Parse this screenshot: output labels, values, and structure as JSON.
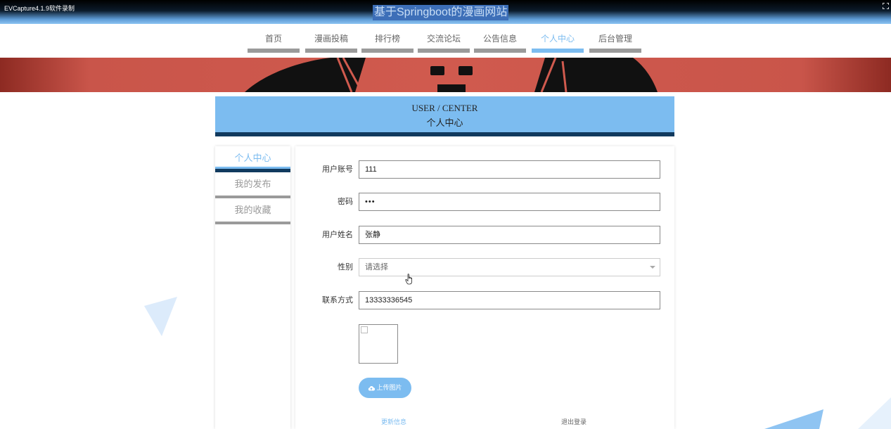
{
  "recorder": {
    "label": "EVCapture4.1.9软件录制"
  },
  "site": {
    "title": "基于Springboot的漫画网站"
  },
  "nav": {
    "items": [
      {
        "label": "首页",
        "active": false
      },
      {
        "label": "漫画投稿",
        "active": false
      },
      {
        "label": "排行榜",
        "active": false
      },
      {
        "label": "交流论坛",
        "active": false
      },
      {
        "label": "公告信息",
        "active": false
      },
      {
        "label": "个人中心",
        "active": true
      },
      {
        "label": "后台管理",
        "active": false
      }
    ]
  },
  "header": {
    "en": "USER / CENTER",
    "cn": "个人中心"
  },
  "sidebar": {
    "items": [
      {
        "label": "个人中心",
        "active": true
      },
      {
        "label": "我的发布",
        "active": false
      },
      {
        "label": "我的收藏",
        "active": false
      }
    ]
  },
  "form": {
    "account": {
      "label": "用户账号",
      "value": "111"
    },
    "password": {
      "label": "密码",
      "value": "•••"
    },
    "name": {
      "label": "用户姓名",
      "value": "张静"
    },
    "gender": {
      "label": "性别",
      "placeholder": "请选择"
    },
    "phone": {
      "label": "联系方式",
      "value": "13333336545"
    },
    "upload_label": "上传图片",
    "update_label": "更新信息",
    "logout_label": "退出登录"
  },
  "colors": {
    "accent": "#7cbcf0",
    "dark_bar": "#113a5e",
    "banner": "#d05a4e"
  },
  "icons": {
    "upload": "cloud-upload-icon",
    "cursor": "hand-pointer-icon",
    "fullscreen": "fullscreen-icon"
  }
}
